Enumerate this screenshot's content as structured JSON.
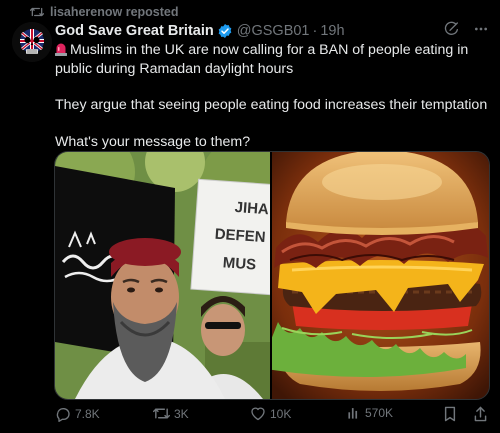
{
  "repost": {
    "label": "lisaherenow reposted",
    "icon": "repost-icon"
  },
  "author": {
    "display_name": "God Save Great Britain",
    "handle": "@GSGB01",
    "time": "19h",
    "dot": "·",
    "verified_color": "#1d9bf0"
  },
  "tweet": {
    "line1": "Muslims in the UK are now calling for a BAN of people eating in public during Ramadan daylight hours",
    "line2": "They argue that seeing people eating food increases their temptation",
    "line3": "What's your message to them?"
  },
  "media": {
    "left_sign_lines": [
      "JIHA",
      "DEFEN",
      "MUS"
    ]
  },
  "actions": {
    "replies": "7.8K",
    "reposts": "3K",
    "likes": "10K",
    "views": "570K"
  },
  "colors": {
    "background": "#000000",
    "text": "#e7e9ea",
    "muted": "#71767b",
    "accent": "#1d9bf0"
  }
}
